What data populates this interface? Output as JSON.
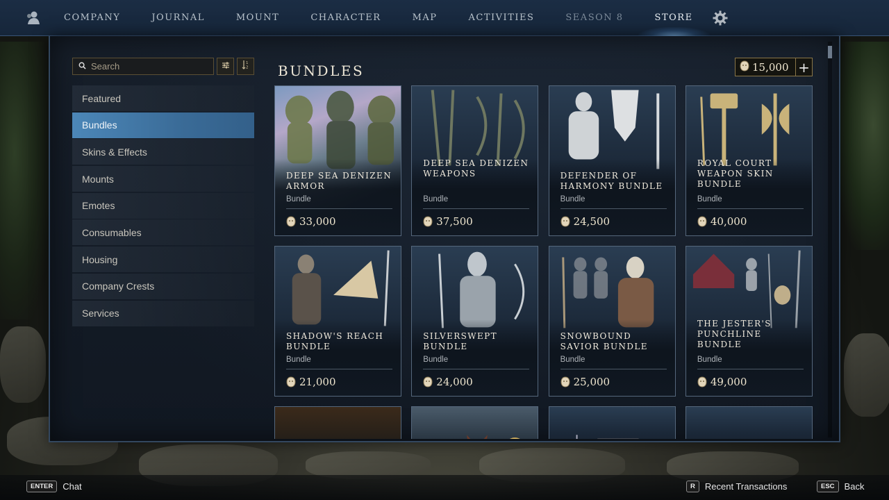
{
  "nav": {
    "items": [
      "COMPANY",
      "JOURNAL",
      "MOUNT",
      "CHARACTER",
      "MAP",
      "ACTIVITIES",
      "SEASON 8",
      "STORE"
    ]
  },
  "sidebar": {
    "search_placeholder": "Search",
    "items": [
      "Featured",
      "Bundles",
      "Skins & Effects",
      "Mounts",
      "Emotes",
      "Consumables",
      "Housing",
      "Company Crests",
      "Services"
    ],
    "active": "Bundles"
  },
  "content": {
    "title": "BUNDLES",
    "balance": "15,000",
    "cards": [
      {
        "name": "Deep Sea Denizen Armor",
        "type": "Bundle",
        "price": "33,000"
      },
      {
        "name": "Deep Sea Denizen Weapons",
        "type": "Bundle",
        "price": "37,500"
      },
      {
        "name": "Defender of Harmony Bundle",
        "type": "Bundle",
        "price": "24,500"
      },
      {
        "name": "Royal Court Weapon Skin Bundle",
        "type": "Bundle",
        "price": "40,000"
      },
      {
        "name": "Shadow's Reach Bundle",
        "type": "Bundle",
        "price": "21,000"
      },
      {
        "name": "Silverswept Bundle",
        "type": "Bundle",
        "price": "24,000"
      },
      {
        "name": "Snowbound Savior Bundle",
        "type": "Bundle",
        "price": "25,000"
      },
      {
        "name": "The Jester's Punchline Bundle",
        "type": "Bundle",
        "price": "49,000"
      }
    ]
  },
  "bottom": {
    "chat_key": "ENTER",
    "chat_label": "Chat",
    "recent_key": "R",
    "recent_label": "Recent Transactions",
    "back_key": "ESC",
    "back_label": "Back"
  },
  "colors": {
    "accent": "#4c87b8",
    "nav_bg": "#1b2d44",
    "currency_border": "#8a7648"
  }
}
